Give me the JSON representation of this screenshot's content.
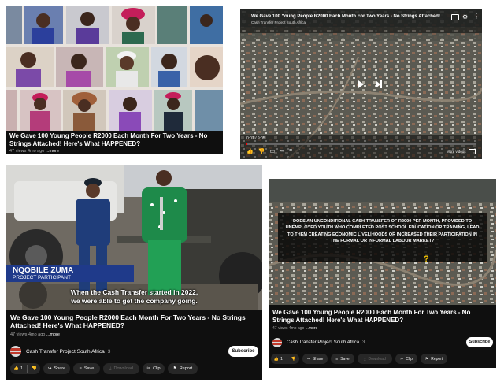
{
  "video_title": "We Gave 100 Young People R2000 Each Month For Two Years - No Strings Attached! Here's What HAPPENED?",
  "top_left": {
    "views_text": "47 views",
    "age_text": "4mo ago",
    "more_text": "...more"
  },
  "top_right": {
    "player_title": "We Gave 100 Young People R2000 Each Month For Two Years - No Strings Attached! Here's Wh...",
    "player_subtitle": "Cash Transfer Project South Africa",
    "time_text": "0:01 / 9:05",
    "more_videos_label": "More videos",
    "progress_fraction": 0.002
  },
  "bottom_left": {
    "lower_third_name": "NQOBILE ZUMA",
    "lower_third_role": "PROJECT PARTICIPANT",
    "subtitle_line1": "When the Cash Transfer started in 2022,",
    "subtitle_line2": "we were able to get the company going.",
    "views_text": "47 views",
    "age_text": "4mo ago",
    "more_text": "...more",
    "channel_name": "Cash Transfer Project South Africa",
    "subscriber_count": "3",
    "subscribe_label": "Subscribe",
    "like_count": "1",
    "share_label": "Share",
    "save_label": "Save",
    "download_label": "Download",
    "clip_label": "Clip",
    "report_label": "Report"
  },
  "bottom_right": {
    "overlay_question": "DOES AN UNCONDITIONAL CASH TRANSFER OF R2000 PER MONTH, PROVIDED TO UNEMPLOYED YOUTH WHO COMPLETED POST SCHOOL EDUCATION OR TRAINING, LEAD TO THEM CREATING ECONOMIC LIVELIHOODS OR INCREASED THEIR PARTICIPATION IN THE FORMAL OR INFORMAL LABOUR MARKET?",
    "views_text": "47 views",
    "age_text": "4mo ago",
    "more_text": "...more",
    "channel_name": "Cash Transfer Project South Africa",
    "subscriber_count": "3",
    "subscribe_label": "Subscribe",
    "like_count": "1",
    "share_label": "Share",
    "save_label": "Save",
    "download_label": "Download",
    "clip_label": "Clip",
    "report_label": "Report"
  },
  "icons": {
    "like": "thumbs-up-icon",
    "dislike": "thumbs-down-icon",
    "share": "share-arrow-icon",
    "save": "save-playlist-icon",
    "download": "download-icon",
    "clip": "scissors-icon",
    "report": "flag-icon",
    "play": "play-icon",
    "next": "next-icon"
  },
  "colors": {
    "panel_bg": "#0f0f0f",
    "chip_bg": "#272727",
    "progress_red": "#ff0000",
    "lower_third_blue": "#1f3a8a"
  }
}
